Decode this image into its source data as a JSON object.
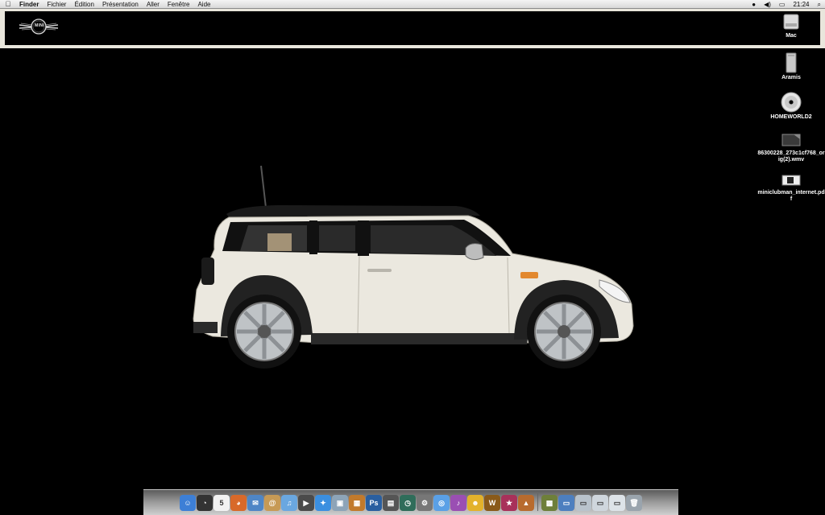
{
  "menubar": {
    "apple_icon": "apple-icon",
    "app_name": "Finder",
    "menus": [
      "Fichier",
      "Édition",
      "Présentation",
      "Aller",
      "Fenêtre",
      "Aide"
    ],
    "clock": "21:24",
    "status_icons": [
      "sync-icon",
      "volume-icon",
      "display-icon",
      "spotlight-icon"
    ]
  },
  "banner": {
    "logo_text": "MINI"
  },
  "desktop_icons": [
    {
      "label": "Mac",
      "icon": "hard-drive-icon"
    },
    {
      "label": "Aramis",
      "icon": "external-drive-icon"
    },
    {
      "label": "HOMEWORLD2",
      "icon": "cd-icon"
    },
    {
      "label": "86300228_273c1cf768_orig(2).wmv",
      "icon": "video-file-icon"
    },
    {
      "label": "miniclubman_internet.pdf",
      "icon": "pdf-file-icon"
    }
  ],
  "dock": {
    "items": [
      {
        "name": "finder-icon",
        "color": "#3d7fd6",
        "glyph": "☺"
      },
      {
        "name": "dashboard-icon",
        "color": "#333333",
        "glyph": "◔"
      },
      {
        "name": "ical-icon",
        "color": "#f2f2f2",
        "glyph": "5"
      },
      {
        "name": "firefox-icon",
        "color": "#d8692a",
        "glyph": "◕"
      },
      {
        "name": "mail-icon",
        "color": "#4f86c6",
        "glyph": "✉"
      },
      {
        "name": "address-book-icon",
        "color": "#c79a55",
        "glyph": "@"
      },
      {
        "name": "itunes-icon",
        "color": "#6aa7e0",
        "glyph": "♫"
      },
      {
        "name": "imovie-icon",
        "color": "#4b4b4b",
        "glyph": "▶"
      },
      {
        "name": "safari-icon",
        "color": "#3b8fe0",
        "glyph": "✦"
      },
      {
        "name": "iphoto-icon",
        "color": "#8da4b8",
        "glyph": "▣"
      },
      {
        "name": "photo-app-icon",
        "color": "#c27a2c",
        "glyph": "▦"
      },
      {
        "name": "photoshop-icon",
        "color": "#2a5fa0",
        "glyph": "Ps"
      },
      {
        "name": "spaces-icon",
        "color": "#555555",
        "glyph": "▤"
      },
      {
        "name": "time-machine-icon",
        "color": "#2f6d5a",
        "glyph": "◷"
      },
      {
        "name": "system-preferences-icon",
        "color": "#777777",
        "glyph": "⚙"
      },
      {
        "name": "ichat-icon",
        "color": "#5aa0e6",
        "glyph": "◎"
      },
      {
        "name": "itunes-purple-icon",
        "color": "#9a4fb3",
        "glyph": "♪"
      },
      {
        "name": "adium-icon",
        "color": "#e3b22b",
        "glyph": "☻"
      },
      {
        "name": "warcraft-icon",
        "color": "#8a5a1a",
        "glyph": "W"
      },
      {
        "name": "game-launcher-icon",
        "color": "#a8315a",
        "glyph": "★"
      },
      {
        "name": "game-art-icon",
        "color": "#b86b2e",
        "glyph": "▲"
      }
    ],
    "stack_items": [
      {
        "name": "applications-folder-icon",
        "color": "#6e7f3a",
        "glyph": "▩"
      },
      {
        "name": "documents-folder-icon",
        "color": "#4d7fbf",
        "glyph": "▭"
      },
      {
        "name": "downloads-folder-icon",
        "color": "#b9c3cc",
        "glyph": "▭"
      },
      {
        "name": "pictures-folder-icon",
        "color": "#cfd6dd",
        "glyph": "▭"
      },
      {
        "name": "documents-stack-icon",
        "color": "#dde3e8",
        "glyph": "▭"
      },
      {
        "name": "trash-icon",
        "color": "#9aa4ad",
        "glyph": "🗑"
      }
    ]
  }
}
